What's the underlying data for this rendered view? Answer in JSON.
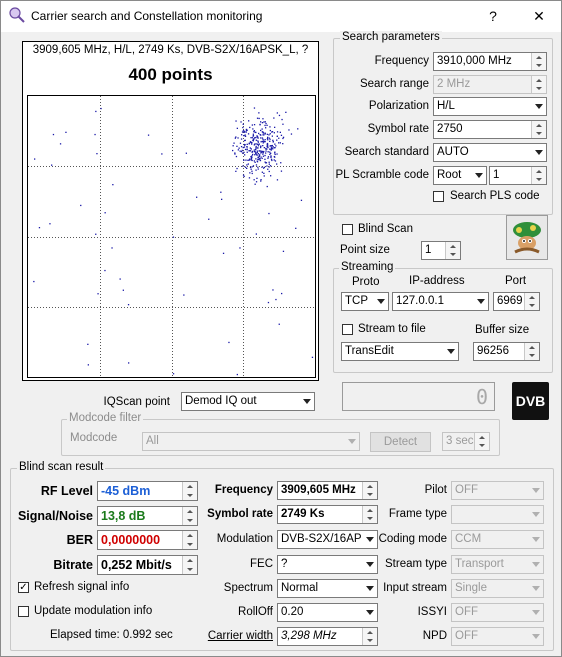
{
  "window": {
    "title": "Carrier search and Constellation monitoring",
    "help_label": "?",
    "close_label": "✕"
  },
  "constellation": {
    "info_line": "3909,605 MHz, H/L, 2749 Ks, DVB-S2X/16APSK_L, ?",
    "points_label": "400 points"
  },
  "search_params": {
    "group_label": "Search parameters",
    "frequency_label": "Frequency",
    "frequency_value": "3910,000 MHz",
    "search_range_label": "Search range",
    "search_range_value": "2 MHz",
    "polarization_label": "Polarization",
    "polarization_value": "H/L",
    "symbol_rate_label": "Symbol rate",
    "symbol_rate_value": "2750",
    "search_standard_label": "Search standard",
    "search_standard_value": "AUTO",
    "pl_scramble_label": "PL Scramble code",
    "pl_scramble_mode": "Root",
    "pl_scramble_value": "1",
    "search_pls_label": "Search PLS code"
  },
  "blind_scan": {
    "checkbox_label": "Blind Scan",
    "point_size_label": "Point size",
    "point_size_value": "1"
  },
  "streaming": {
    "group_label": "Streaming",
    "proto_label": "Proto",
    "proto_value": "TCP",
    "ip_label": "IP-address",
    "ip_value": "127.0.0.1",
    "port_label": "Port",
    "port_value": "6969",
    "stream_to_file_label": "Stream to file",
    "buffer_size_label": "Buffer size",
    "target_value": "TransEdit",
    "buffer_size_value": "96256"
  },
  "level_display": "0",
  "iqscan": {
    "label": "IQScan point",
    "value": "Demod IQ out"
  },
  "modcode_filter": {
    "group_label": "Modcode filter",
    "modcode_label": "Modcode",
    "modcode_value": "All",
    "detect_label": "Detect",
    "timeout_value": "3 sec"
  },
  "logo_label": "DVB",
  "result": {
    "group_label": "Blind scan result",
    "rf_level_label": "RF Level",
    "rf_level_value": "-45 dBm",
    "snr_label": "Signal/Noise",
    "snr_value": "13,8 dB",
    "ber_label": "BER",
    "ber_value": "0,0000000",
    "bitrate_label": "Bitrate",
    "bitrate_value": "0,252 Mbit/s",
    "refresh_label": "Refresh signal info",
    "update_mod_label": "Update modulation info",
    "elapsed_label": "Elapsed time: 0.992 sec",
    "frequency_label": "Frequency",
    "frequency_value": "3909,605 MHz",
    "symbol_rate_label": "Symbol rate",
    "symbol_rate_value": "2749 Ks",
    "modulation_label": "Modulation",
    "modulation_value": "DVB-S2X/16APSK",
    "fec_label": "FEC",
    "fec_value": "?",
    "spectrum_label": "Spectrum",
    "spectrum_value": "Normal",
    "rolloff_label": "RollOff",
    "rolloff_value": "0.20",
    "carrier_width_label": "Carrier width",
    "carrier_width_value": "3,298 MHz",
    "pilot_label": "Pilot",
    "pilot_value": "OFF",
    "frame_type_label": "Frame type",
    "frame_type_value": "",
    "coding_mode_label": "Coding mode",
    "coding_mode_value": "CCM",
    "stream_type_label": "Stream type",
    "stream_type_value": "Transport",
    "input_stream_label": "Input stream",
    "input_stream_value": "Single",
    "issyi_label": "ISSYI",
    "issyi_value": "OFF",
    "npd_label": "NPD",
    "npd_value": "OFF"
  },
  "colors": {
    "rf_level": "#1c5fd6",
    "snr": "#1a7a1a",
    "ber": "#d00000",
    "points": "#1a1aa8"
  }
}
